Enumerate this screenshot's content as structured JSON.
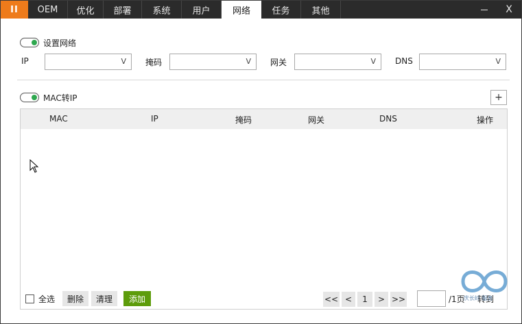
{
  "app": {
    "logo_label": "II"
  },
  "tabs": [
    {
      "label": "OEM"
    },
    {
      "label": "优化"
    },
    {
      "label": "部署"
    },
    {
      "label": "系统"
    },
    {
      "label": "用户"
    },
    {
      "label": "网络"
    },
    {
      "label": "任务"
    },
    {
      "label": "其他"
    }
  ],
  "active_tab": "网络",
  "window": {
    "close_label": "X"
  },
  "network": {
    "toggle_label": "设置网络",
    "toggle_on": true,
    "fields": [
      {
        "label": "IP",
        "value": ""
      },
      {
        "label": "掩码",
        "value": ""
      },
      {
        "label": "网关",
        "value": ""
      },
      {
        "label": "DNS",
        "value": ""
      }
    ],
    "chevron": "V"
  },
  "mac_to_ip": {
    "toggle_label": "MAC转IP",
    "toggle_on": true,
    "add_label": "+",
    "columns": [
      "MAC",
      "IP",
      "掩码",
      "网关",
      "DNS",
      "操作"
    ],
    "rows": []
  },
  "footer": {
    "select_all_label": "全选",
    "delete_label": "删除",
    "clear_label": "清理",
    "add_label": "添加",
    "pager": {
      "first_label": "<<",
      "prev_label": "<",
      "current_page": "1",
      "next_label": ">",
      "last_label": ">>",
      "page_input_value": "",
      "total_pages_label": "/1页",
      "goto_label": "转到"
    }
  },
  "watermark_text": "庆长岭 服务",
  "colors": {
    "accent_orange": "#ee7b1b",
    "tabbar_bg": "#2b2b2b",
    "toggle_green": "#2fa84f",
    "add_button_green": "#5d9c0b"
  }
}
